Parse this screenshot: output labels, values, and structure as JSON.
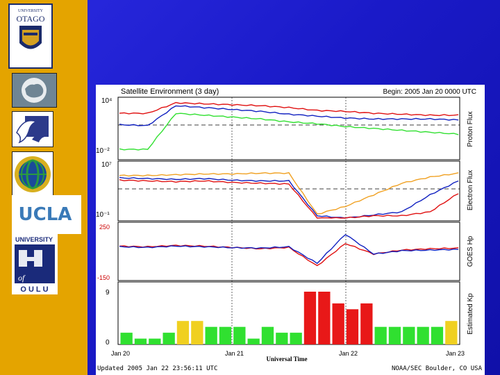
{
  "logos": {
    "otago": {
      "line1": "UNIVERSITY",
      "line2": "OTAGO"
    },
    "ucla": "UCLA",
    "oulu": {
      "top": "UNIVERSITY",
      "of": "of",
      "bottom": "OULU"
    }
  },
  "colors": {
    "red": "#e01010",
    "blue": "#1020c0",
    "green": "#30e030",
    "orange": "#f0a020",
    "kp_yellow": "#f0d020",
    "kp_red": "#e81818"
  },
  "chart_data": [
    {
      "type": "line",
      "title": "Satellite Environment (3 day)",
      "begin_label": "Begin: 2005 Jan 20 0000 UTC",
      "ylabel": "Proton Flux",
      "yticks": [
        "10⁴",
        "10⁻²"
      ],
      "x": [
        "Jan 20",
        "Jan 21",
        "Jan 22",
        "Jan 23"
      ],
      "series": [
        {
          "color": "red",
          "values": [
            2.6,
            2.6,
            3.7,
            3.6,
            3.5,
            3.4,
            3.2,
            2.9,
            2.8,
            2.6,
            2.5,
            2.4,
            2.4
          ]
        },
        {
          "color": "blue",
          "values": [
            1.4,
            1.3,
            3.4,
            3.2,
            3.0,
            2.8,
            2.5,
            2.3,
            2.1,
            2.0,
            2.0,
            2.0,
            1.9
          ]
        },
        {
          "color": "green",
          "values": [
            -1.2,
            -1.2,
            2.6,
            2.4,
            2.2,
            2.0,
            1.7,
            1.5,
            1.2,
            1.0,
            0.8,
            0.6,
            0.4
          ]
        }
      ]
    },
    {
      "type": "line",
      "ylabel": "Electron Flux",
      "yticks": [
        "10⁷",
        "10⁻¹"
      ],
      "x": [
        "Jan 20",
        "Jan 21",
        "Jan 22",
        "Jan 23"
      ],
      "series": [
        {
          "color": "orange",
          "values": [
            5.5,
            5.5,
            5.6,
            5.7,
            5.7,
            5.8,
            5.8,
            0.5,
            1.5,
            3.0,
            4.5,
            5.3,
            5.8
          ]
        },
        {
          "color": "blue",
          "values": [
            5.2,
            5.1,
            5.0,
            5.1,
            4.9,
            4.8,
            4.8,
            0.3,
            0.0,
            0.4,
            0.8,
            3.0,
            4.8
          ]
        },
        {
          "color": "red",
          "values": [
            4.9,
            4.8,
            4.7,
            4.8,
            4.6,
            4.5,
            4.4,
            0.0,
            0.0,
            0.3,
            0.3,
            0.8,
            3.2
          ]
        }
      ]
    },
    {
      "type": "line",
      "ylabel": "GOES Hp",
      "yticks": [
        "250",
        "-150"
      ],
      "x": [
        "Jan 20",
        "Jan 21",
        "Jan 22",
        "Jan 23"
      ],
      "series": [
        {
          "color": "red",
          "values": [
            90,
            85,
            95,
            90,
            80,
            70,
            80,
            -60,
            110,
            30,
            60,
            70,
            75
          ]
        },
        {
          "color": "blue",
          "values": [
            85,
            80,
            90,
            85,
            78,
            75,
            85,
            -40,
            180,
            30,
            55,
            60,
            65
          ]
        }
      ]
    },
    {
      "type": "bar",
      "ylabel": "Estimated Kp",
      "xlabel": "Universal Time",
      "yticks": [
        "9",
        "0"
      ],
      "x": [
        "Jan 20",
        "Jan 21",
        "Jan 22",
        "Jan 23"
      ],
      "values": [
        2,
        1,
        1,
        2,
        4,
        4,
        3,
        3,
        3,
        1,
        3,
        2,
        2,
        9,
        9,
        7,
        6,
        7,
        3,
        3,
        3,
        3,
        3,
        4
      ],
      "colors": [
        "green",
        "green",
        "green",
        "green",
        "yellow",
        "yellow",
        "green",
        "green",
        "green",
        "green",
        "green",
        "green",
        "green",
        "red",
        "red",
        "red",
        "red",
        "red",
        "green",
        "green",
        "green",
        "green",
        "green",
        "yellow"
      ]
    }
  ],
  "footer": {
    "left": "Updated 2005 Jan 22 23:56:11 UTC",
    "right": "NOAA/SEC Boulder, CO USA"
  }
}
